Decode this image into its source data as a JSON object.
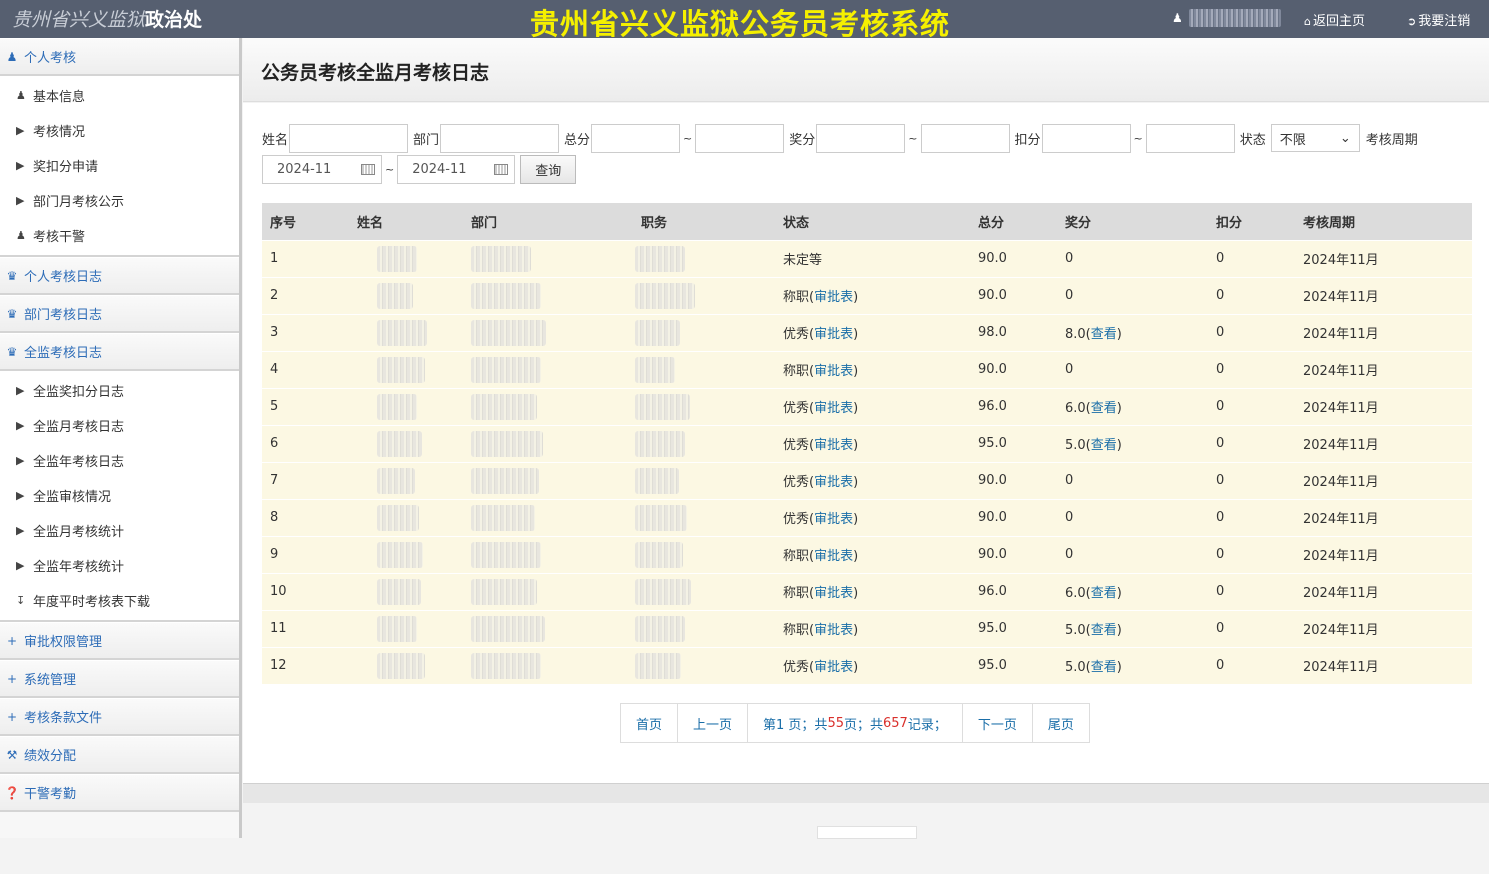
{
  "header": {
    "logo_italic": "贵州省兴义监狱",
    "logo_bold": "政治处",
    "app_title": "贵州省兴义监狱公务员考核系统",
    "home_label": "返回主页",
    "logout_label": "我要注销"
  },
  "sidebar": {
    "g_personal": "个人考核",
    "items_personal": [
      "基本信息",
      "考核情况",
      "奖扣分申请",
      "部门月考核公示",
      "考核干警"
    ],
    "g_personal_log": "个人考核日志",
    "g_dept_log": "部门考核日志",
    "g_all_log": "全监考核日志",
    "items_all": [
      "全监奖扣分日志",
      "全监月考核日志",
      "全监年考核日志",
      "全监审核情况",
      "全监月考核统计",
      "全监年考核统计",
      "年度平时考核表下载"
    ],
    "g_approval": "审批权限管理",
    "g_system": "系统管理",
    "g_docs": "考核条款文件",
    "g_perf": "绩效分配",
    "g_attend": "干警考勤"
  },
  "main": {
    "title": "公务员考核全监月考核日志"
  },
  "filter": {
    "name_label": "姓名",
    "dept_label": "部门",
    "total_label": "总分",
    "bonus_label": "奖分",
    "deduct_label": "扣分",
    "status_label": "状态",
    "status_value": "不限",
    "period_label": "考核周期",
    "date_from": "2024-11",
    "date_to": "2024-11",
    "tilde": "~",
    "query_label": "查询"
  },
  "table": {
    "headers": [
      "序号",
      "姓名",
      "部门",
      "职务",
      "状态",
      "总分",
      "奖分",
      "扣分",
      "考核周期"
    ],
    "approve_link": "审批表",
    "view_link": "查看",
    "rows": [
      {
        "no": "1",
        "status": "未定等",
        "approve": "",
        "total": "90.0",
        "bonus": "0",
        "view": "",
        "deduct": "0",
        "period": "2024年11月"
      },
      {
        "no": "2",
        "status": "称职(",
        "approve": "审批表",
        "total": "90.0",
        "bonus": "0",
        "view": "",
        "deduct": "0",
        "period": "2024年11月"
      },
      {
        "no": "3",
        "status": "优秀(",
        "approve": "审批表",
        "total": "98.0",
        "bonus": "8.0(",
        "view": "查看",
        "deduct": "0",
        "period": "2024年11月"
      },
      {
        "no": "4",
        "status": "称职(",
        "approve": "审批表",
        "total": "90.0",
        "bonus": "0",
        "view": "",
        "deduct": "0",
        "period": "2024年11月"
      },
      {
        "no": "5",
        "status": "优秀(",
        "approve": "审批表",
        "total": "96.0",
        "bonus": "6.0(",
        "view": "查看",
        "deduct": "0",
        "period": "2024年11月"
      },
      {
        "no": "6",
        "status": "优秀(",
        "approve": "审批表",
        "total": "95.0",
        "bonus": "5.0(",
        "view": "查看",
        "deduct": "0",
        "period": "2024年11月"
      },
      {
        "no": "7",
        "status": "优秀(",
        "approve": "审批表",
        "total": "90.0",
        "bonus": "0",
        "view": "",
        "deduct": "0",
        "period": "2024年11月"
      },
      {
        "no": "8",
        "status": "优秀(",
        "approve": "审批表",
        "total": "90.0",
        "bonus": "0",
        "view": "",
        "deduct": "0",
        "period": "2024年11月"
      },
      {
        "no": "9",
        "status": "称职(",
        "approve": "审批表",
        "total": "90.0",
        "bonus": "0",
        "view": "",
        "deduct": "0",
        "period": "2024年11月"
      },
      {
        "no": "10",
        "status": "称职(",
        "approve": "审批表",
        "total": "96.0",
        "bonus": "6.0(",
        "view": "查看",
        "deduct": "0",
        "period": "2024年11月"
      },
      {
        "no": "11",
        "status": "称职(",
        "approve": "审批表",
        "total": "95.0",
        "bonus": "5.0(",
        "view": "查看",
        "deduct": "0",
        "period": "2024年11月"
      },
      {
        "no": "12",
        "status": "优秀(",
        "approve": "审批表",
        "total": "95.0",
        "bonus": "5.0(",
        "view": "查看",
        "deduct": "0",
        "period": "2024年11月"
      }
    ]
  },
  "pager": {
    "first": "首页",
    "prev": "上一页",
    "info_a": "第1 页；共",
    "pages": "55",
    "info_b": " 页；共",
    "records": "657",
    "info_c": " 记录；",
    "next": "下一页",
    "last": "尾页"
  }
}
